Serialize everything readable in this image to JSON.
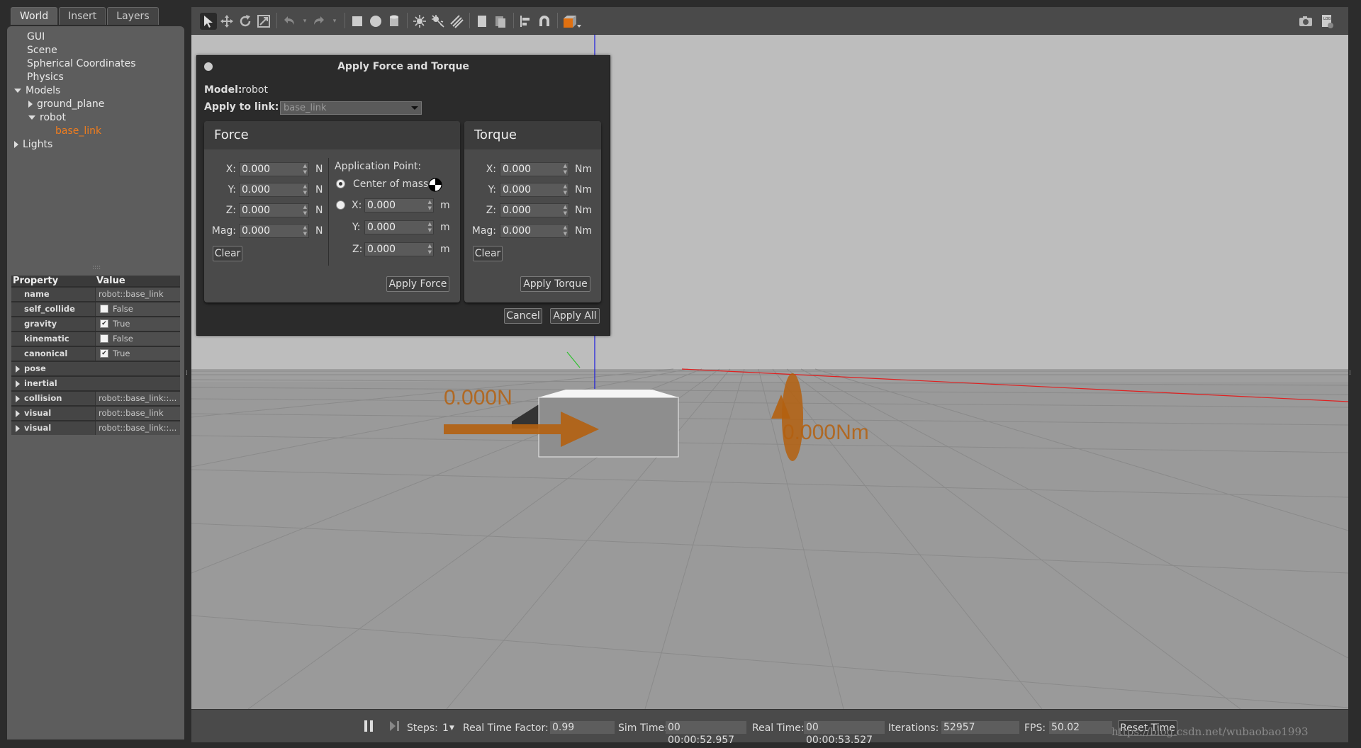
{
  "left_panel": {
    "tabs": [
      "World",
      "Insert",
      "Layers"
    ],
    "tree": [
      {
        "label": "GUI",
        "indent": 0,
        "expander": "none"
      },
      {
        "label": "Scene",
        "indent": 0,
        "expander": "none"
      },
      {
        "label": "Spherical Coordinates",
        "indent": 0,
        "expander": "none"
      },
      {
        "label": "Physics",
        "indent": 0,
        "expander": "none"
      },
      {
        "label": "Models",
        "indent": 0,
        "expander": "expanded"
      },
      {
        "label": "ground_plane",
        "indent": 1,
        "expander": "collapsed"
      },
      {
        "label": "robot",
        "indent": 1,
        "expander": "expanded"
      },
      {
        "label": "base_link",
        "indent": 2,
        "expander": "none",
        "selected": true
      },
      {
        "label": "Lights",
        "indent": 0,
        "expander": "collapsed"
      }
    ],
    "properties": {
      "header": {
        "property": "Property",
        "value": "Value"
      },
      "rows": [
        {
          "key": "name",
          "value": "robot::base_link",
          "type": "text"
        },
        {
          "key": "self_collide",
          "value": "False",
          "type": "check",
          "checked": false
        },
        {
          "key": "gravity",
          "value": "True",
          "type": "check",
          "checked": true
        },
        {
          "key": "kinematic",
          "value": "False",
          "type": "check",
          "checked": false
        },
        {
          "key": "canonical",
          "value": "True",
          "type": "check",
          "checked": true
        },
        {
          "key": "pose",
          "value": "",
          "type": "group"
        },
        {
          "key": "inertial",
          "value": "",
          "type": "group"
        },
        {
          "key": "collision",
          "value": "robot::base_link::...",
          "type": "group"
        },
        {
          "key": "visual",
          "value": "robot::base_link",
          "type": "group"
        },
        {
          "key": "visual",
          "value": "robot::base_link::...",
          "type": "group"
        }
      ]
    }
  },
  "toolbar": {
    "tools": [
      "select-arrow-icon",
      "translate-icon",
      "rotate-icon",
      "scale-icon",
      "undo-icon",
      "undo-dropdown-icon",
      "redo-icon",
      "redo-dropdown-icon",
      "box-icon",
      "sphere-icon",
      "cylinder-icon",
      "point-light-icon",
      "spot-light-icon",
      "directional-light-icon",
      "copy-icon",
      "paste-icon",
      "align-icon",
      "snap-icon",
      "view-angle-icon",
      "screenshot-icon",
      "log-icon"
    ]
  },
  "dialog": {
    "title": "Apply Force and Torque",
    "model_label": "Model:",
    "model_value": "robot",
    "link_label": "Apply to link:",
    "link_value": "base_link",
    "force": {
      "title": "Force",
      "x_label": "X:",
      "x": "0.000",
      "y_label": "Y:",
      "y": "0.000",
      "z_label": "Z:",
      "z": "0.000",
      "mag_label": "Mag:",
      "mag": "0.000",
      "unit": "N",
      "clear": "Clear",
      "apply": "Apply Force",
      "application_point": "Application Point:",
      "center_of_mass": "Center of mass",
      "ap_x": "0.000",
      "ap_y": "0.000",
      "ap_z": "0.000",
      "ap_unit": "m"
    },
    "torque": {
      "title": "Torque",
      "x_label": "X:",
      "x": "0.000",
      "y_label": "Y:",
      "y": "0.000",
      "z_label": "Z:",
      "z": "0.000",
      "mag_label": "Mag:",
      "mag": "0.000",
      "unit": "Nm",
      "clear": "Clear",
      "apply": "Apply Torque"
    },
    "cancel": "Cancel",
    "apply_all": "Apply All"
  },
  "viewport": {
    "force_label": "0.000N",
    "torque_label": "0.000Nm",
    "colors": {
      "sky": "#bdbdbd",
      "ground": "#9a9a9a",
      "arrow": "#b4600f",
      "x_axis": "#e02020",
      "z_axis": "#1a1ae0"
    }
  },
  "bottom_bar": {
    "steps_label": "Steps:",
    "steps_value": "1",
    "rtf_label": "Real Time Factor:",
    "rtf_value": "0.99",
    "sim_time_label": "Sim Time:",
    "sim_time_value": "00 00:00:52.957",
    "real_time_label": "Real Time:",
    "real_time_value": "00 00:00:53.527",
    "iterations_label": "Iterations:",
    "iterations_value": "52957",
    "fps_label": "FPS:",
    "fps_value": "50.02",
    "reset_time": "Reset Time"
  },
  "watermark": "https://blog.csdn.net/wubaobao1993"
}
